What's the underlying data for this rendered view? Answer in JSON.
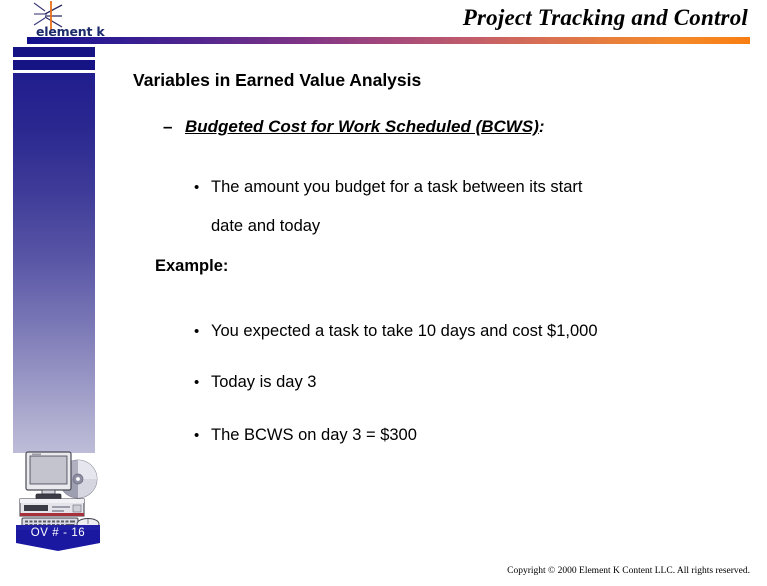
{
  "brand": {
    "logo_text": "element k",
    "logo_icon": "starburst-asterisk-icon",
    "accent_start": "#11108c",
    "accent_mid": "#a4487c",
    "accent_end": "#f97e12",
    "sidebar_top": "#211e8e",
    "sidebar_bottom": "#bdbcd8"
  },
  "header": {
    "title": "Project Tracking and Control"
  },
  "sidebar": {
    "computer_icon": "desktop-computer-icon",
    "slide_marker": "OV # - 16"
  },
  "content": {
    "heading": "Variables in Earned Value Analysis",
    "subheading": {
      "dash": "–",
      "term": "Budgeted Cost for Work Scheduled (BCWS)",
      "colon": ":"
    },
    "definition": {
      "bullet": "•",
      "line1": "The amount you budget for a task between its start",
      "line2": "date and today"
    },
    "example_label": "Example:",
    "example_bullets": [
      {
        "bullet": "•",
        "text": "You expected a task to take 10 days and cost $1,000"
      },
      {
        "bullet": "•",
        "text": "Today is day 3"
      },
      {
        "bullet": "•",
        "text": "The BCWS on day 3 = $300"
      }
    ]
  },
  "footer": {
    "copyright": "Copyright © 2000 Element K Content LLC. All rights reserved."
  }
}
